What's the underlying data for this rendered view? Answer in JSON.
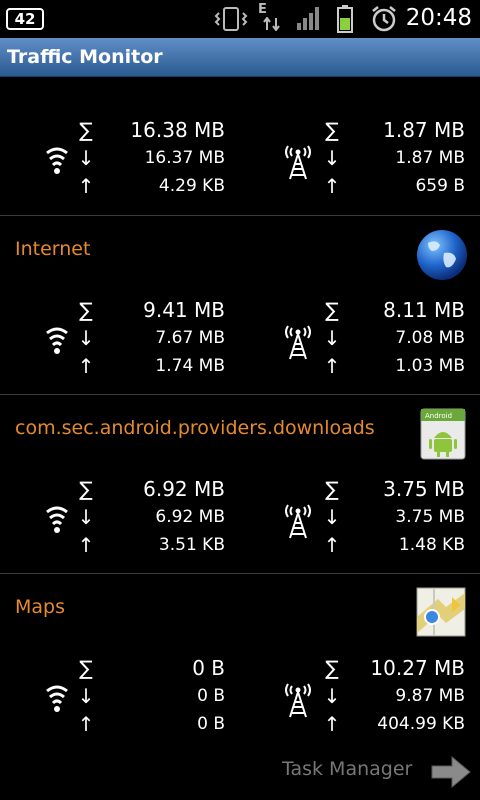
{
  "status_bar": {
    "notification_count": "42",
    "network_type": "E",
    "time": "20:48"
  },
  "title": "Traffic Monitor",
  "sections": [
    {
      "name": "",
      "wifi": {
        "total": "16.38 MB",
        "down": "16.37 MB",
        "up": "4.29 KB"
      },
      "mobile": {
        "total": "1.87 MB",
        "down": "1.87 MB",
        "up": "659 B"
      }
    },
    {
      "name": "Internet",
      "icon": "globe-icon",
      "wifi": {
        "total": "9.41 MB",
        "down": "7.67 MB",
        "up": "1.74 MB"
      },
      "mobile": {
        "total": "8.11 MB",
        "down": "7.08 MB",
        "up": "1.03 MB"
      }
    },
    {
      "name": "com.sec.android.providers.downloads",
      "icon": "android-icon",
      "wifi": {
        "total": "6.92 MB",
        "down": "6.92 MB",
        "up": "3.51 KB"
      },
      "mobile": {
        "total": "3.75 MB",
        "down": "3.75 MB",
        "up": "1.48 KB"
      }
    },
    {
      "name": "Maps",
      "icon": "maps-icon",
      "wifi": {
        "total": "0 B",
        "down": "0 B",
        "up": "0 B"
      },
      "mobile": {
        "total": "10.27 MB",
        "down": "9.87 MB",
        "up": "404.99 KB"
      }
    }
  ],
  "symbols": {
    "total": "∑",
    "down": "↓",
    "up": "↑"
  },
  "task_manager": "Task Manager"
}
